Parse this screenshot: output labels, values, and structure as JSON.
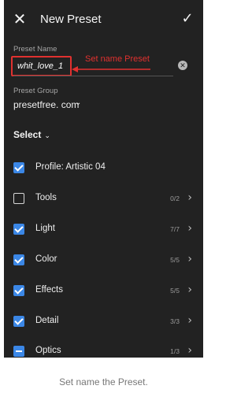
{
  "header": {
    "close_icon": "close-icon",
    "title": "New Preset",
    "confirm_icon": "check-icon"
  },
  "preset_name": {
    "label": "Preset Name",
    "value": "whit_love_1",
    "annotation": "Set name Preset",
    "annotation_color": "#e0312f"
  },
  "preset_group": {
    "label": "Preset Group",
    "value": "presetfree. com"
  },
  "select": {
    "label": "Select"
  },
  "items": [
    {
      "label": "Profile: Artistic 04",
      "count": "",
      "state": "checked"
    },
    {
      "label": "Tools",
      "count": "0/2",
      "state": "unchecked"
    },
    {
      "label": "Light",
      "count": "7/7",
      "state": "checked"
    },
    {
      "label": "Color",
      "count": "5/5",
      "state": "checked"
    },
    {
      "label": "Effects",
      "count": "5/5",
      "state": "checked"
    },
    {
      "label": "Detail",
      "count": "3/3",
      "state": "checked"
    },
    {
      "label": "Optics",
      "count": "1/3",
      "state": "partial"
    }
  ],
  "caption": "Set name the Preset.",
  "colors": {
    "background": "#222222",
    "checkbox_accent": "#3b87e6"
  }
}
